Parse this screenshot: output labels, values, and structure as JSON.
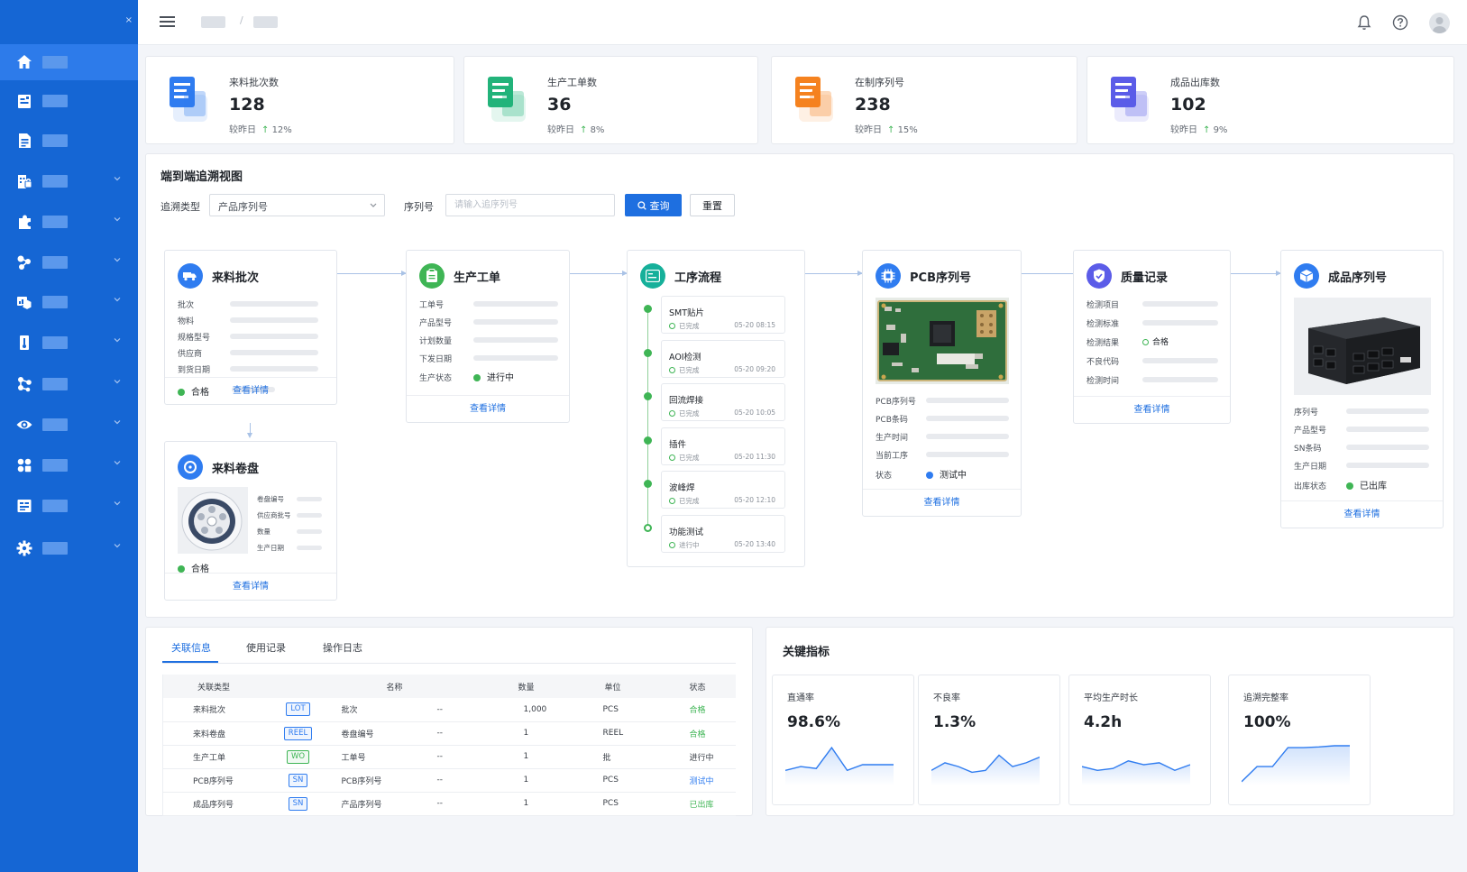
{
  "sidebar": {
    "close_icon": "×",
    "items": [
      {
        "icon": "home-icon",
        "active": true,
        "has_children": false
      },
      {
        "icon": "calendar-form-icon",
        "has_children": false
      },
      {
        "icon": "document-icon",
        "has_children": false
      },
      {
        "icon": "building-lock-icon",
        "has_children": true
      },
      {
        "icon": "puzzle-icon",
        "has_children": true
      },
      {
        "icon": "process-nodes-icon",
        "has_children": true
      },
      {
        "icon": "cube-chart-icon",
        "has_children": true
      },
      {
        "icon": "thermometer-icon",
        "has_children": true
      },
      {
        "icon": "hierarchy-icon",
        "has_children": true
      },
      {
        "icon": "eye-icon",
        "has_children": true
      },
      {
        "icon": "grid-icon",
        "has_children": true
      },
      {
        "icon": "list-report-icon",
        "has_children": true
      },
      {
        "icon": "gear-icon",
        "has_children": true
      }
    ]
  },
  "header": {
    "breadcrumb_sep": "/",
    "icons": [
      "bell-icon",
      "help-icon",
      "avatar"
    ]
  },
  "stats": [
    {
      "label": "来料批次数",
      "value": "128",
      "compare": "较昨日",
      "change": "12%",
      "color": "#2f7cf0"
    },
    {
      "label": "生产工单数",
      "value": "36",
      "compare": "较昨日",
      "change": "8%",
      "color": "#22b37a"
    },
    {
      "label": "在制序列号",
      "value": "238",
      "compare": "较昨日",
      "change": "15%",
      "color": "#f5821f"
    },
    {
      "label": "成品出库数",
      "value": "102",
      "compare": "较昨日",
      "change": "9%",
      "color": "#5b5ce8"
    }
  ],
  "trace": {
    "title": "端到端追溯视图",
    "filter_type_label": "追溯类型",
    "filter_type_value": "产品序列号",
    "serial_label": "序列号",
    "serial_placeholder": "请输入追序列号",
    "query_button": "查询",
    "reset_button": "重置",
    "view_detail": "查看详情",
    "material_batch": {
      "title": "来料批次",
      "fields": [
        "批次",
        "物料",
        "规格型号",
        "供应商",
        "到货日期"
      ],
      "status": "合格"
    },
    "material_reel": {
      "title": "来料卷盘",
      "fields": [
        "卷盘编号",
        "供应商批号",
        "数量",
        "生产日期"
      ],
      "status": "合格"
    },
    "work_order": {
      "title": "生产工单",
      "fields": [
        "工单号",
        "产品型号",
        "计划数量",
        "下发日期"
      ],
      "status_label": "生产状态",
      "status": "进行中"
    },
    "process": {
      "title": "工序流程",
      "steps": [
        {
          "name": "SMT贴片",
          "state": "已完成",
          "time": "05-20 08:15"
        },
        {
          "name": "AOI检测",
          "state": "已完成",
          "time": "05-20 09:20"
        },
        {
          "name": "回流焊接",
          "state": "已完成",
          "time": "05-20 10:05"
        },
        {
          "name": "插件",
          "state": "已完成",
          "time": "05-20 11:30"
        },
        {
          "name": "波峰焊",
          "state": "已完成",
          "time": "05-20 12:10"
        },
        {
          "name": "功能测试",
          "state": "进行中",
          "time": "05-20 13:40"
        }
      ]
    },
    "pcb": {
      "title": "PCB序列号",
      "fields": [
        "PCB序列号",
        "PCB条码",
        "生产时间",
        "当前工序"
      ],
      "status_label": "状态",
      "status": "测试中"
    },
    "quality": {
      "title": "质量记录",
      "fields": [
        "检测项目",
        "检测标准",
        "检测结果",
        "不良代码",
        "检测时间"
      ],
      "result": "合格"
    },
    "product": {
      "title": "成品序列号",
      "fields": [
        "序列号",
        "产品型号",
        "SN条码",
        "生产日期"
      ],
      "status_label": "出库状态",
      "status": "已出库"
    }
  },
  "relations": {
    "tabs": [
      "关联信息",
      "使用记录",
      "操作日志"
    ],
    "columns": [
      "关联类型",
      "名称",
      "数量",
      "单位",
      "状态"
    ],
    "rows": [
      {
        "type": "来料批次",
        "tag": "LOT",
        "tag_color": "#2f7cf0",
        "name": "批次",
        "name_value": "--",
        "qty": "1,000",
        "unit": "PCS",
        "status": "合格",
        "status_color": "#3fb555"
      },
      {
        "type": "来料卷盘",
        "tag": "REEL",
        "tag_color": "#2f7cf0",
        "name": "卷盘编号",
        "name_value": "--",
        "qty": "1",
        "unit": "REEL",
        "status": "合格",
        "status_color": "#3fb555"
      },
      {
        "type": "生产工单",
        "tag": "WO",
        "tag_color": "#3fb555",
        "name": "工单号",
        "name_value": "--",
        "qty": "1",
        "unit": "批",
        "status": "进行中",
        "status_color": "#3b4048"
      },
      {
        "type": "PCB序列号",
        "tag": "SN",
        "tag_color": "#2f7cf0",
        "name": "PCB序列号",
        "name_value": "--",
        "qty": "1",
        "unit": "PCS",
        "status": "测试中",
        "status_color": "#2f7cf0"
      },
      {
        "type": "成品序列号",
        "tag": "SN",
        "tag_color": "#2f7cf0",
        "name": "产品序列号",
        "name_value": "--",
        "qty": "1",
        "unit": "PCS",
        "status": "已出库",
        "status_color": "#3fb555"
      }
    ]
  },
  "kpis": {
    "title": "关键指标",
    "items": [
      {
        "label": "直通率",
        "value": "98.6%",
        "trend": [
          0.35,
          0.45,
          0.4,
          0.95,
          0.35,
          0.5,
          0.5,
          0.5
        ]
      },
      {
        "label": "不良率",
        "value": "1.3%",
        "trend": [
          0.35,
          0.55,
          0.45,
          0.3,
          0.35,
          0.75,
          0.45,
          0.55,
          0.7
        ]
      },
      {
        "label": "平均生产时长",
        "value": "4.2h",
        "trend": [
          0.45,
          0.35,
          0.4,
          0.6,
          0.5,
          0.55,
          0.35,
          0.5
        ]
      },
      {
        "label": "追溯完整率",
        "value": "100%",
        "trend": [
          0.05,
          0.45,
          0.45,
          0.95,
          0.95,
          0.97,
          1.0,
          1.0
        ]
      }
    ]
  },
  "colors": {
    "primary": "#1e6fe0",
    "sidebar": "#1566d4",
    "success": "#3fb555"
  }
}
